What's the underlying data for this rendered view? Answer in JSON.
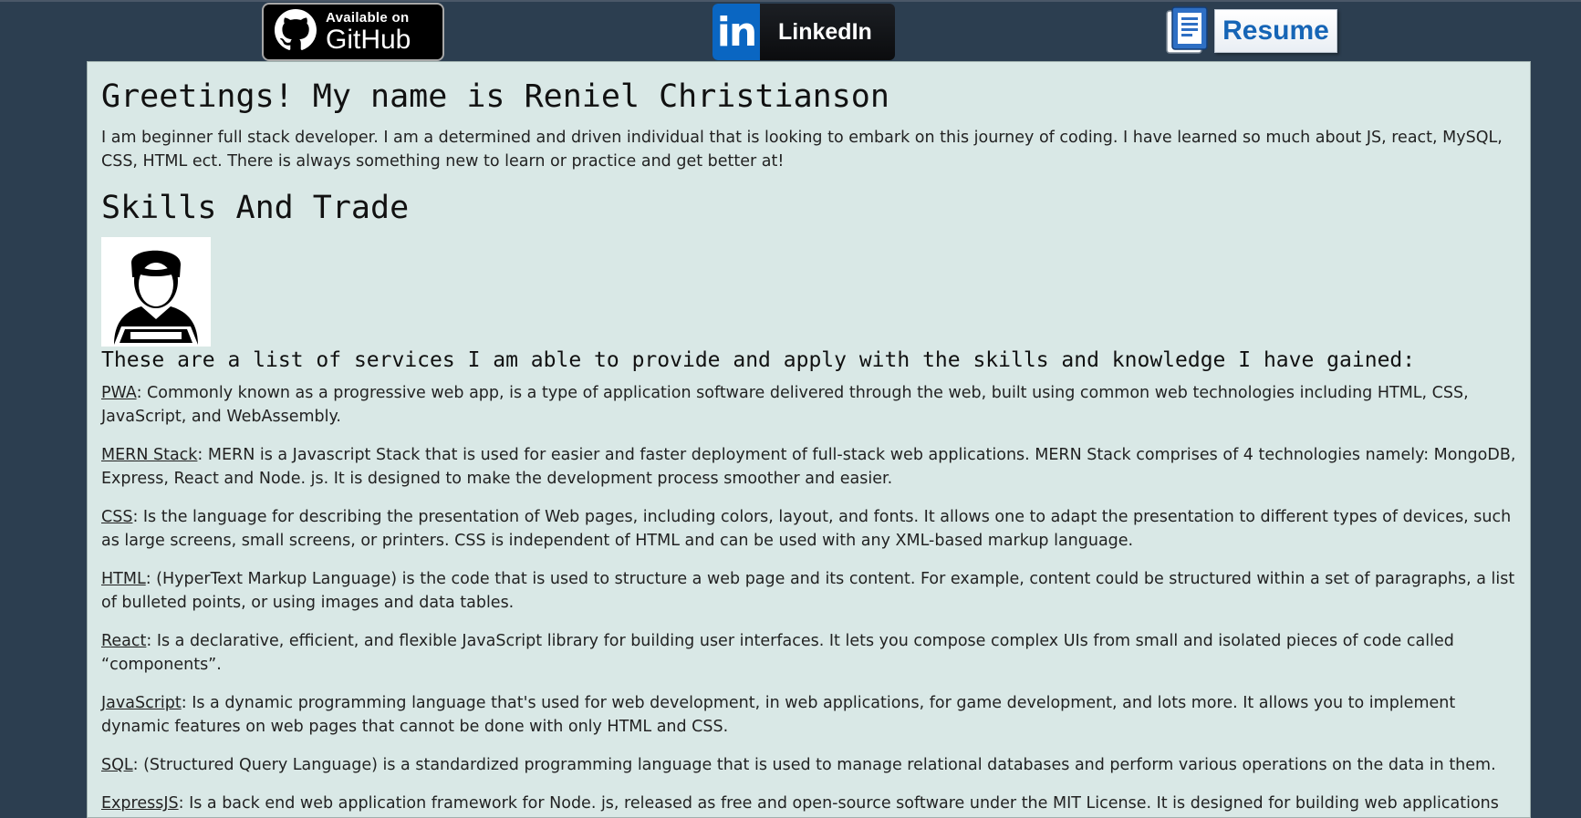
{
  "header": {
    "github": {
      "small": "Available on",
      "big": "GitHub"
    },
    "linkedin": {
      "label": "LinkedIn",
      "logo": "in"
    },
    "resume": {
      "label": "Resume"
    }
  },
  "main": {
    "greeting": "Greetings! My name is Reniel Christianson",
    "intro": "I am beginner full stack developer. I am a determined and driven individual that is looking to embark on this journey of coding. I have learned so much about JS, react, MySQL, CSS, HTML ect. There is always something new to learn or practice and get better at!",
    "skills_heading": "Skills And Trade",
    "services_heading": "These are a list of services I am able to provide and apply with the skills and knowledge I have gained:",
    "skills": [
      {
        "name": "PWA",
        "desc": ": Commonly known as a progressive web app, is a type of application software delivered through the web, built using common web technologies including HTML, CSS, JavaScript, and WebAssembly."
      },
      {
        "name": "MERN Stack",
        "desc": ": MERN is a Javascript Stack that is used for easier and faster deployment of full-stack web applications. MERN Stack comprises of 4 technologies namely: MongoDB, Express, React and Node. js. It is designed to make the development process smoother and easier."
      },
      {
        "name": "CSS",
        "desc": ": Is the language for describing the presentation of Web pages, including colors, layout, and fonts. It allows one to adapt the presentation to different types of devices, such as large screens, small screens, or printers. CSS is independent of HTML and can be used with any XML-based markup language."
      },
      {
        "name": "HTML",
        "desc": ": (HyperText Markup Language) is the code that is used to structure a web page and its content. For example, content could be structured within a set of paragraphs, a list of bulleted points, or using images and data tables."
      },
      {
        "name": "React",
        "desc": ": Is a declarative, efficient, and flexible JavaScript library for building user interfaces. It lets you compose complex UIs from small and isolated pieces of code called “components”."
      },
      {
        "name": "JavaScript",
        "desc": ": Is a dynamic programming language that's used for web development, in web applications, for game development, and lots more. It allows you to implement dynamic features on web pages that cannot be done with only HTML and CSS."
      },
      {
        "name": "SQL",
        "desc": ": (Structured Query Language) is a standardized programming language that is used to manage relational databases and perform various operations on the data in them."
      },
      {
        "name": "ExpressJS",
        "desc": ": Is a back end web application framework for Node. js, released as free and open-source software under the MIT License. It is designed for building web applications and APIs. It has been"
      }
    ]
  },
  "colors": {
    "page_bg": "#2c3e50",
    "content_bg": "#d9e8e6",
    "linkedin_blue": "#0a66c2",
    "resume_blue": "#1665b6"
  },
  "icons": [
    "github-octocat-icon",
    "linkedin-in-icon",
    "resume-document-icon",
    "developer-avatar-icon"
  ]
}
